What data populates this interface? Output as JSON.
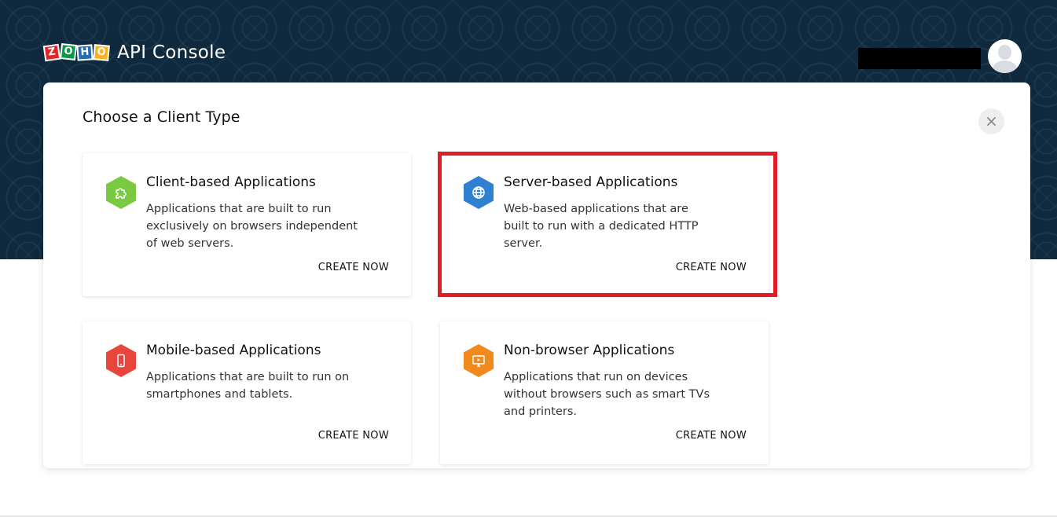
{
  "app": {
    "logo_letters": [
      "Z",
      "O",
      "H",
      "O"
    ],
    "title": "API Console"
  },
  "modal": {
    "title": "Choose a Client Type",
    "close_symbol": "×"
  },
  "cards": [
    {
      "title": "Client-based Applications",
      "description": "Applications that are built to run exclusively on browsers independent of web servers.",
      "cta": "CREATE NOW",
      "icon": "puzzle-icon",
      "color": "#7ac943"
    },
    {
      "title": "Server-based Applications",
      "description": "Web-based applications that are built to run with a dedicated HTTP server.",
      "cta": "CREATE NOW",
      "icon": "globe-icon",
      "color": "#2f80d1"
    },
    {
      "title": "Mobile-based Applications",
      "description": "Applications that are built to run on smartphones and tablets.",
      "cta": "CREATE NOW",
      "icon": "smartphone-icon",
      "color": "#e8453c"
    },
    {
      "title": "Non-browser Applications",
      "description": "Applications that run on devices without browsers such as smart TVs and printers.",
      "cta": "CREATE NOW",
      "icon": "monitor-icon",
      "color": "#f08a1d"
    }
  ],
  "colors": {
    "banner": "#0f2a3f",
    "highlight": "#e31c25"
  }
}
